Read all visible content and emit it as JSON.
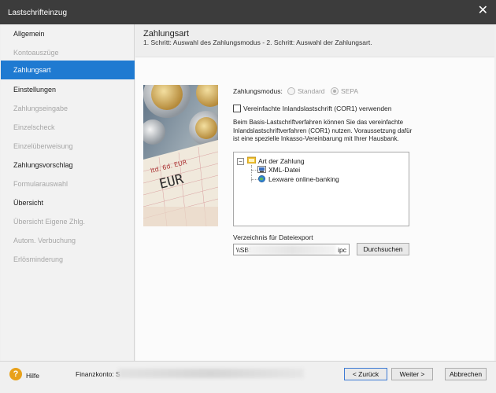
{
  "window": {
    "title": "Lastschrifteinzug"
  },
  "sidebar": {
    "items": [
      {
        "label": "Allgemein"
      },
      {
        "label": "Kontoauszüge"
      },
      {
        "label": "Zahlungsart"
      },
      {
        "label": "Einstellungen"
      },
      {
        "label": "Zahlungseingabe"
      },
      {
        "label": "Einzelscheck"
      },
      {
        "label": "Einzelüberweisung"
      },
      {
        "label": "Zahlungsvorschlag"
      },
      {
        "label": "Formularauswahl"
      },
      {
        "label": "Übersicht"
      },
      {
        "label": "Übersicht Eigene Zhlg."
      },
      {
        "label": "Autom. Verbuchung"
      },
      {
        "label": "Erlösminderung"
      }
    ]
  },
  "header": {
    "title": "Zahlungsart",
    "subtitle": "1. Schritt: Auswahl des Zahlungsmodus - 2. Schritt: Auswahl der Zahlungsart."
  },
  "form": {
    "mode_label": "Zahlungsmodus:",
    "mode_standard": "Standard",
    "mode_sepa": "SEPA",
    "cor1_label": "Vereinfachte Inlandslastschrift (COR1) verwenden",
    "description": "Beim Basis-Lastschriftverfahren können Sie das vereinfachte Inlandslastschriftverfahren (COR1) nutzen. Voraussetzung dafür ist eine spezielle Inkasso-Vereinbarung mit Ihrer Hausbank.",
    "tree": {
      "root": "Art der Zahlung",
      "children": [
        "XML-Datei",
        "Lexware online-banking"
      ]
    },
    "dir_label": "Verzeichnis für Dateiexport",
    "dir_value_start": "\\\\SBS",
    "dir_value_end": "ipc",
    "browse_button": "Durchsuchen"
  },
  "footer": {
    "help": "Hilfe",
    "finanzkonto_label": "Finanzkonto: S",
    "back": "< Zurück",
    "next": "Weiter >",
    "cancel": "Abbrechen"
  }
}
